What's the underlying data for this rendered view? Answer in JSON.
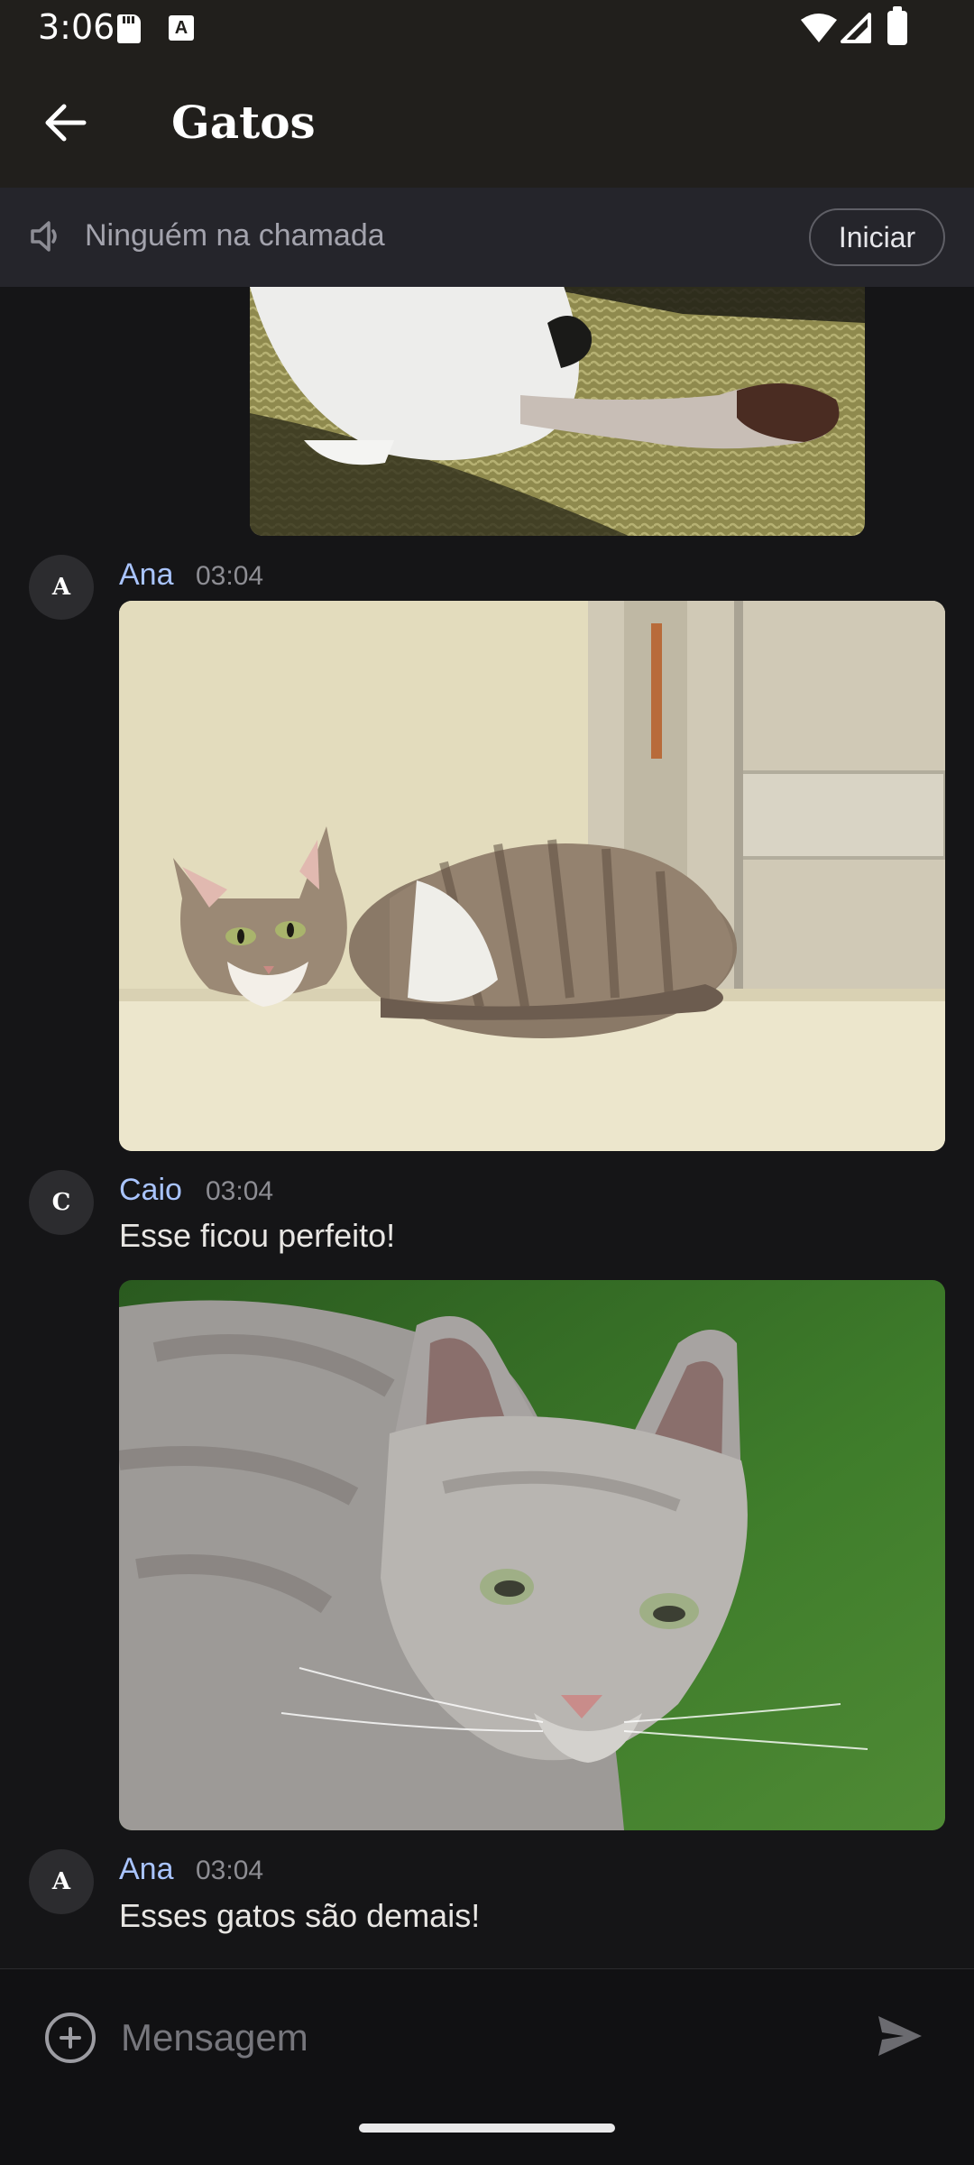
{
  "status_bar": {
    "time": "3:06",
    "icons": [
      "sd-card-icon",
      "a-icon",
      "wifi-icon",
      "signal-icon",
      "battery-icon"
    ]
  },
  "app_bar": {
    "title": "Gatos",
    "back_icon": "arrow-back-icon"
  },
  "call_bar": {
    "status": "Ninguém na chamada",
    "start_label": "Iniciar",
    "icon": "speaker-icon"
  },
  "messages": [
    {
      "type": "image",
      "content": "gato branco com rabo escuro sobre tapete (parcial)"
    },
    {
      "initial": "A",
      "author": "Ana",
      "time": "03:04",
      "type": "image",
      "content": "gato tigrado deitado junto a parede"
    },
    {
      "initial": "C",
      "author": "Caio",
      "time": "03:04",
      "text": "Esse ficou perfeito!",
      "type": "image",
      "content": "gato cinza deitado na grama"
    },
    {
      "initial": "A",
      "author": "Ana",
      "time": "03:04",
      "text": "Esses gatos são demais!"
    }
  ],
  "composer": {
    "placeholder": "Mensagem",
    "value": "",
    "add_icon": "add-circle-icon",
    "send_icon": "send-icon"
  },
  "colors": {
    "background": "#151517",
    "app_bar": "#211f1c",
    "call_bar": "#25252b",
    "author": "#a9c4ff",
    "timestamp": "#8d8d93"
  }
}
